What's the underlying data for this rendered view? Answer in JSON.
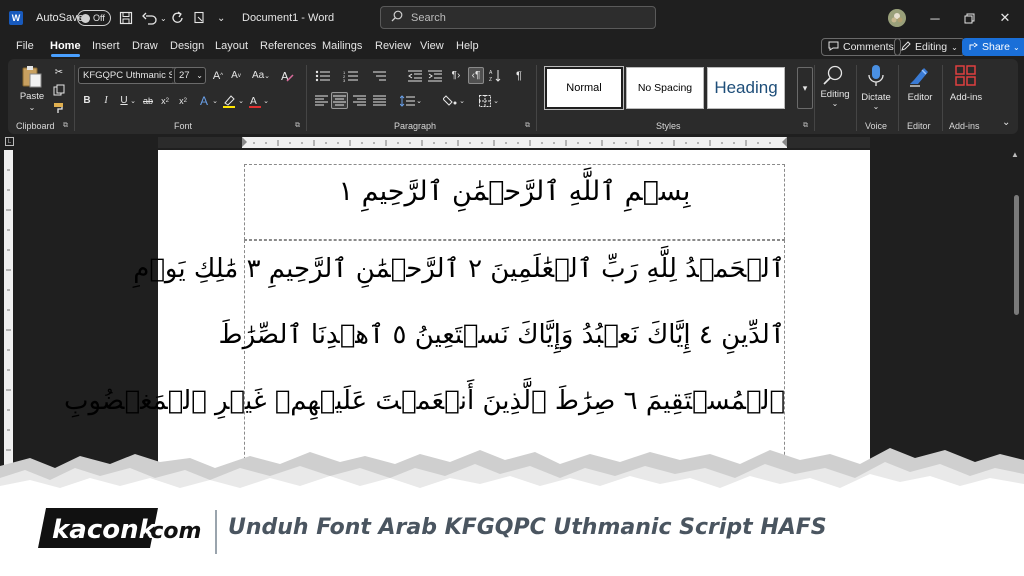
{
  "titlebar": {
    "autosave_label": "AutoSave",
    "toggle_state": "Off",
    "document_title": "Document1  -  Word",
    "search_placeholder": "Search"
  },
  "menu": {
    "tabs": [
      "File",
      "Home",
      "Insert",
      "Draw",
      "Design",
      "Layout",
      "References",
      "Mailings",
      "Review",
      "View",
      "Help"
    ],
    "active_tab": "Home",
    "comments_label": "Comments",
    "editing_label": "Editing",
    "share_label": "Share"
  },
  "ribbon": {
    "paste_label": "Paste",
    "clipboard_label": "Clipboard",
    "font_name": "KFGQPC Uthmanic S",
    "font_size": "27",
    "font_label": "Font",
    "paragraph_label": "Paragraph",
    "styles_label": "Styles",
    "style_normal": "Normal",
    "style_nospacing": "No Spacing",
    "style_heading": "Heading",
    "editing_label": "Editing",
    "dictate_label": "Dictate",
    "voice_label": "Voice",
    "editor_label": "Editor",
    "editor_group_label": "Editor",
    "addins_label": "Add-ins",
    "addins_group_label": "Add-ins"
  },
  "document": {
    "line1": "بِسۡمِ ٱللَّهِ ٱلرَّحۡمَٰنِ ٱلرَّحِيمِ ١",
    "line2": "ٱلۡحَمۡدُ لِلَّهِ رَبِّ ٱلۡعَٰلَمِينَ ٢ ٱلرَّحۡمَٰنِ ٱلرَّحِيمِ ٣ مَٰلِكِ يَوۡمِ",
    "line3": "ٱلدِّينِ ٤ إِيَّاكَ نَعۡبُدُ وَإِيَّاكَ نَسۡتَعِينُ ٥ ٱهۡدِنَا ٱلصِّرَٰطَ",
    "line4": "ٱلۡمُسۡتَقِيمَ ٦ صِرَٰطَ ٱلَّذِينَ أَنۡعَمۡتَ عَلَيۡهِمۡ غَيۡرِ ٱلۡمَغۡضُوبِ"
  },
  "banner": {
    "logo_text": "kaconk",
    "logo_suffix": ".com",
    "title": "Unduh Font Arab KFGQPC Uthmanic Script HAFS"
  },
  "colors": {
    "accent": "#4aa0ff",
    "share_blue": "#1a6fd8",
    "word_blue": "#185abd",
    "banner_text": "#4a5560"
  }
}
